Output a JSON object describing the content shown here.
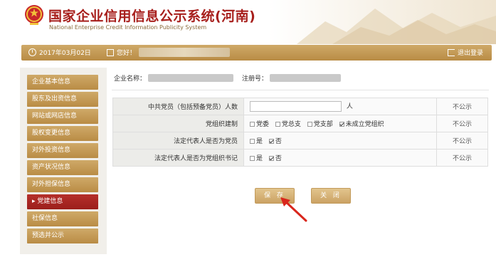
{
  "header": {
    "title_cn": "国家企业信用信息公示系统(河南)",
    "title_en": "National Enterprise Credit Information Publicity System"
  },
  "topbar": {
    "date": "2017年03月02日",
    "greeting": "您好！",
    "logout_label": "退出登录"
  },
  "sidebar": {
    "items": [
      {
        "label": "企业基本信息"
      },
      {
        "label": "股东及出资信息"
      },
      {
        "label": "网站或网店信息"
      },
      {
        "label": "股权变更信息"
      },
      {
        "label": "对外投资信息"
      },
      {
        "label": "资产状况信息"
      },
      {
        "label": "对外担保信息"
      },
      {
        "label": "▸ 党建信息"
      },
      {
        "label": "社保信息"
      },
      {
        "label": "预选并公示"
      }
    ],
    "active_index": 7
  },
  "company": {
    "name_label": "企业名称：",
    "reg_label": "注册号："
  },
  "form": {
    "rows": [
      {
        "label": "中共党员（包括预备党员）人数",
        "unit": "人",
        "publicity": "不公示"
      },
      {
        "label": "党组织建制",
        "options": [
          "党委",
          "党总支",
          "党支部",
          "未成立党组织"
        ],
        "checked": "未成立党组织",
        "publicity": "不公示"
      },
      {
        "label": "法定代表人是否为党员",
        "options": [
          "是",
          "否"
        ],
        "checked": "否",
        "publicity": "不公示"
      },
      {
        "label": "法定代表人是否为党组织书记",
        "options": [
          "是",
          "否"
        ],
        "checked": "否",
        "publicity": "不公示"
      }
    ]
  },
  "buttons": {
    "save_label": "保 存",
    "close_label": "关 闭"
  },
  "colors": {
    "brand_red": "#a71f1c",
    "gold": "#c49a55",
    "active_red": "#9c1f1b",
    "arrow_red": "#d9261c"
  }
}
